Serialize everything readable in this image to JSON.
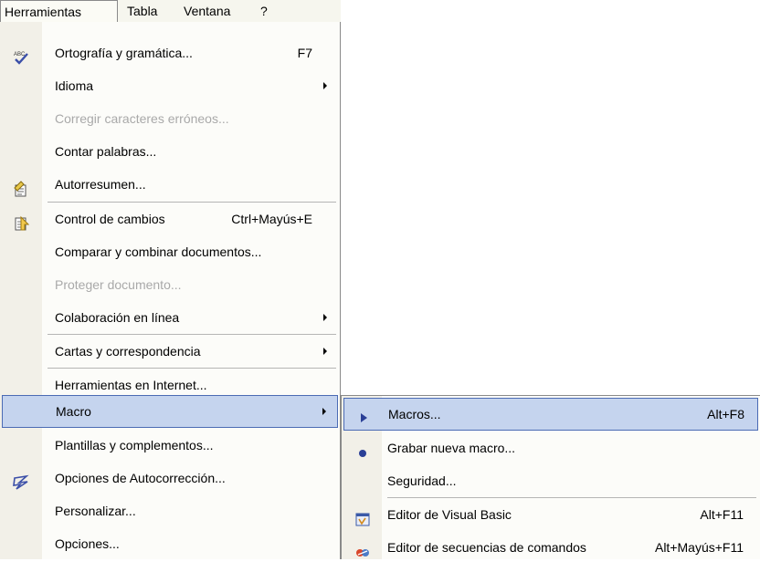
{
  "menubar": {
    "items": [
      {
        "label": "Herramientas",
        "active": true
      },
      {
        "label": "Tabla"
      },
      {
        "label": "Ventana"
      },
      {
        "label": "?"
      }
    ]
  },
  "tools_menu": {
    "items": [
      {
        "label": "Ortografía y gramática...",
        "shortcut": "F7",
        "icon": "spelling-check-icon"
      },
      {
        "label": "Idioma",
        "submenu": true
      },
      {
        "label": "Corregir caracteres erróneos...",
        "disabled": true
      },
      {
        "label": "Contar palabras..."
      },
      {
        "label": "Autorresumen...",
        "icon": "autosummary-icon"
      },
      {
        "label": "Control de cambios",
        "shortcut": "Ctrl+Mayús+E",
        "icon": "track-changes-icon"
      },
      {
        "label": "Comparar y combinar documentos..."
      },
      {
        "label": "Proteger documento...",
        "disabled": true
      },
      {
        "label": "Colaboración en línea",
        "submenu": true
      },
      {
        "label": "Cartas y correspondencia",
        "submenu": true
      },
      {
        "label": "Herramientas en Internet..."
      },
      {
        "label": "Macro",
        "submenu": true,
        "highlighted": true
      },
      {
        "label": "Plantillas y complementos..."
      },
      {
        "label": "Opciones de Autocorrección...",
        "icon": "autocorrect-icon"
      },
      {
        "label": "Personalizar..."
      },
      {
        "label": "Opciones..."
      }
    ]
  },
  "macro_submenu": {
    "items": [
      {
        "label": "Macros...",
        "shortcut": "Alt+F8",
        "icon": "play-icon",
        "highlighted": true
      },
      {
        "label": "Grabar nueva macro...",
        "icon": "record-icon"
      },
      {
        "label": "Seguridad..."
      },
      {
        "label": "Editor de Visual Basic",
        "shortcut": "Alt+F11",
        "icon": "visual-basic-editor-icon"
      },
      {
        "label": "Editor de secuencias de comandos",
        "shortcut": "Alt+Mayús+F11",
        "icon": "script-editor-icon"
      }
    ]
  },
  "colors": {
    "highlight": "#c5d4ee",
    "highlight_border": "#4b6bb4",
    "gutter": "#f2f0e8",
    "disabled_text": "#a9a9a9"
  }
}
